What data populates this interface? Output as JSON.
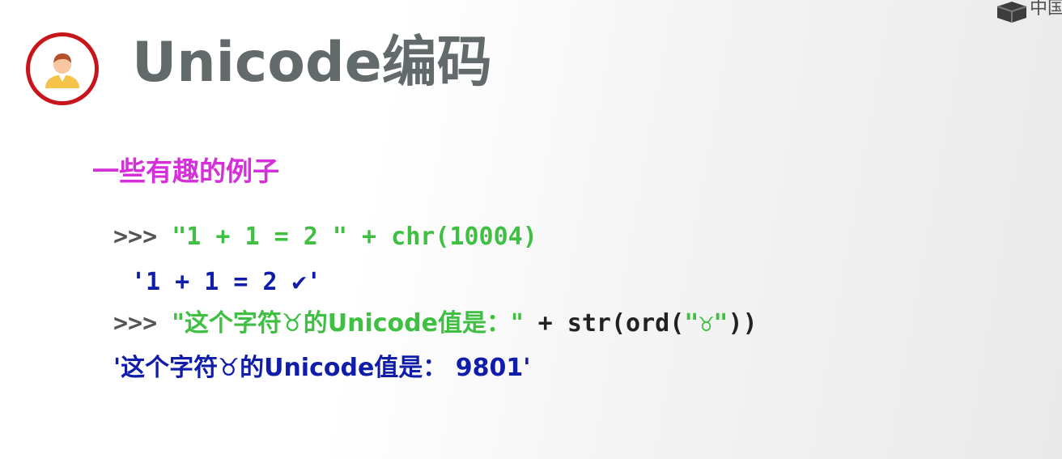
{
  "header": {
    "title": "Unicode编码",
    "avatar_icon": "person-avatar-icon",
    "accent_color": "#c8151c",
    "corner_logo_text": "中国"
  },
  "content": {
    "subtitle": "一些有趣的例子",
    "lines": [
      {
        "prompt": ">>> ",
        "code_string": "\"1 + 1 = 2 \" + chr(10004)"
      },
      {
        "output": "'1 + 1 = 2 ✔'"
      },
      {
        "prompt": ">>> ",
        "code_string": "\"这个字符♉的Unicode值是：\"",
        "code_op": " + str(ord(",
        "code_arg": "\"♉\"",
        "code_close": "))"
      },
      {
        "output": "'这个字符♉的Unicode值是： 9801'"
      }
    ]
  },
  "colors": {
    "subtitle": "#d42fd9",
    "code_string": "#3fc043",
    "output": "#0f1da8",
    "title": "#626a6b"
  }
}
